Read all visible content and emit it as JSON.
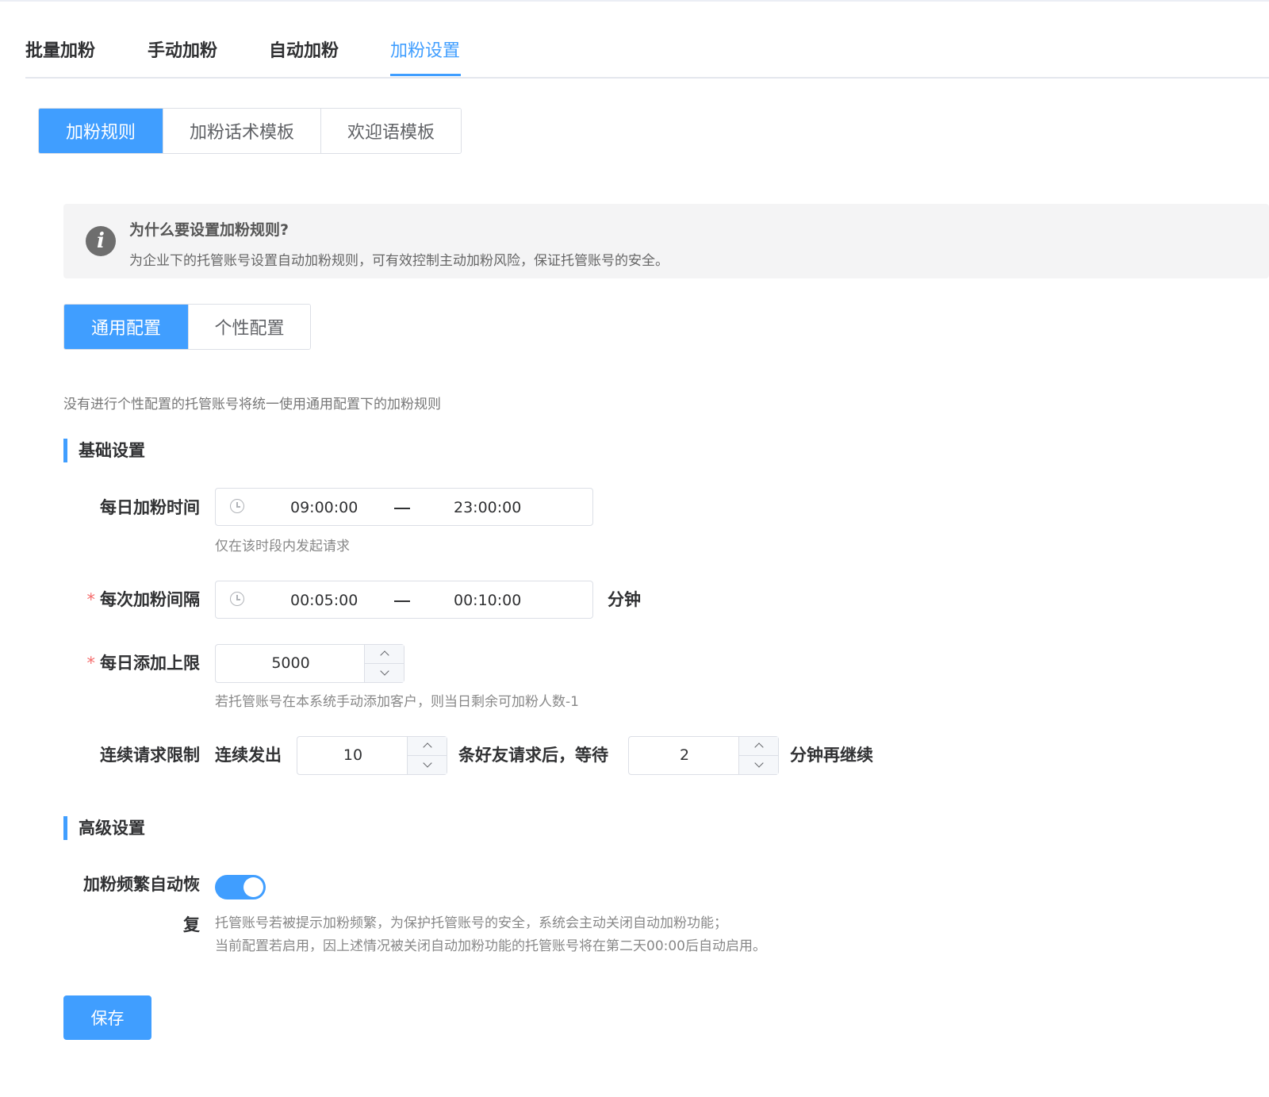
{
  "colors": {
    "accent": "#409eff",
    "required": "#f56c6c"
  },
  "top_tabs": [
    {
      "label": "批量加粉"
    },
    {
      "label": "手动加粉"
    },
    {
      "label": "自动加粉"
    },
    {
      "label": "加粉设置",
      "active": true
    }
  ],
  "sub_tabs": [
    {
      "label": "加粉规则",
      "active": true
    },
    {
      "label": "加粉话术模板"
    },
    {
      "label": "欢迎语模板"
    }
  ],
  "info": {
    "icon": "info-icon",
    "title": "为什么要设置加粉规则?",
    "desc": "为企业下的托管账号设置自动加粉规则，可有效控制主动加粉风险，保证托管账号的安全。"
  },
  "config_tabs": [
    {
      "label": "通用配置",
      "active": true
    },
    {
      "label": "个性配置"
    }
  ],
  "config_note": "没有进行个性配置的托管账号将统一使用通用配置下的加粉规则",
  "basic": {
    "title": "基础设置",
    "daily_time": {
      "label": "每日加粉时间",
      "start": "09:00:00",
      "end": "23:00:00",
      "hint": "仅在该时段内发起请求"
    },
    "interval": {
      "label": "每次加粉间隔",
      "start": "00:05:00",
      "end": "00:10:00",
      "unit": "分钟"
    },
    "daily_limit": {
      "label": "每日添加上限",
      "value": "5000",
      "hint": "若托管账号在本系统手动添加客户，则当日剩余可加粉人数-1"
    },
    "continuous": {
      "label": "连续请求限制",
      "prefix": "连续发出",
      "count": "10",
      "middle": "条好友请求后，等待",
      "wait": "2",
      "suffix": "分钟再继续"
    }
  },
  "advanced": {
    "title": "高级设置",
    "auto_recover": {
      "label_line1": "加粉频繁自动恢",
      "label_line2": "复",
      "enabled": true,
      "hint_line1": "托管账号若被提示加粉频繁，为保护托管账号的安全，系统会主动关闭自动加粉功能；",
      "hint_line2": "当前配置若启用，因上述情况被关闭自动加粉功能的托管账号将在第二天00:00后自动启用。"
    }
  },
  "save_label": "保存"
}
